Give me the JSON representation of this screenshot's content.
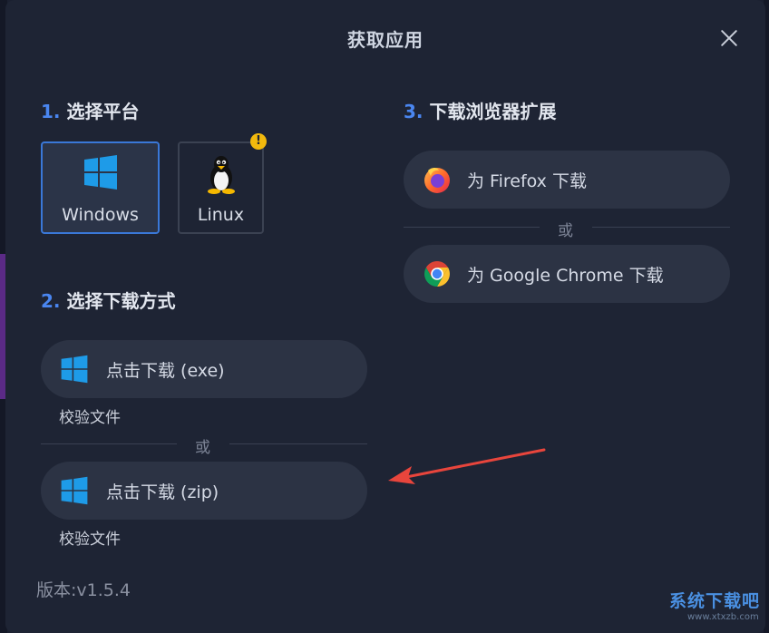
{
  "dialog": {
    "title": "获取应用"
  },
  "section1": {
    "number": "1.",
    "title": "选择平台",
    "platforms": [
      {
        "label": "Windows",
        "selected": true,
        "icon": "windows-icon"
      },
      {
        "label": "Linux",
        "selected": false,
        "icon": "linux-tux-icon",
        "badge": "!"
      }
    ]
  },
  "section2": {
    "number": "2.",
    "title": "选择下载方式",
    "options": [
      {
        "label": "点击下载 (exe)",
        "verify": "校验文件",
        "icon": "windows-icon"
      },
      {
        "label": "点击下载 (zip)",
        "verify": "校验文件",
        "icon": "windows-icon"
      }
    ],
    "separator": "或"
  },
  "section3": {
    "number": "3.",
    "title": "下载浏览器扩展",
    "options": [
      {
        "label": "为 Firefox 下载",
        "icon": "firefox-icon"
      },
      {
        "label": "为 Google Chrome 下载",
        "icon": "chrome-icon"
      }
    ],
    "separator": "或"
  },
  "footer": {
    "version": "版本:v1.5.4"
  },
  "watermark": {
    "text": "系统下载吧",
    "sub": "www.xtxzb.com"
  },
  "colors": {
    "accent": "#4a86f0",
    "selected_border": "#3a78d8",
    "windows_blue": "#1e9be8",
    "warning": "#f2b90d",
    "annotation_arrow": "#e8453c"
  }
}
